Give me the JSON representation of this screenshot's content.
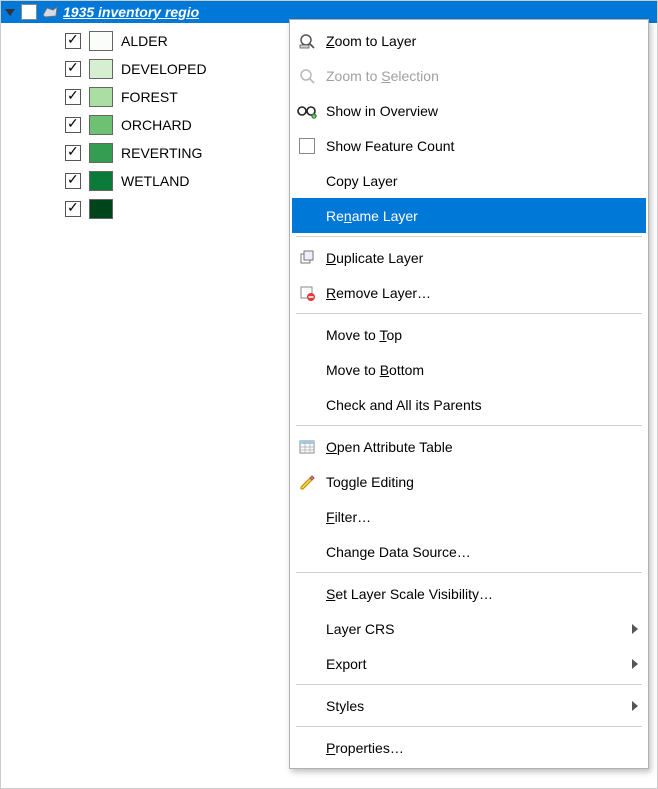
{
  "layer": {
    "title": "1935 inventory regio",
    "checked": false,
    "legend": [
      {
        "label": "ALDER",
        "checked": true,
        "color": "#fbfdfa"
      },
      {
        "label": "DEVELOPED",
        "checked": true,
        "color": "#d7efd1"
      },
      {
        "label": "FOREST",
        "checked": true,
        "color": "#aadea3"
      },
      {
        "label": "ORCHARD",
        "checked": true,
        "color": "#6ec173"
      },
      {
        "label": "REVERTING",
        "checked": true,
        "color": "#359d51"
      },
      {
        "label": "WETLAND",
        "checked": true,
        "color": "#0c7a38"
      },
      {
        "label": "",
        "checked": true,
        "color": "#00441b"
      }
    ]
  },
  "menu": {
    "items": [
      {
        "kind": "item",
        "label_html": "<u>Z</u>oom to Layer",
        "icon": "zoom-layer",
        "disabled": false,
        "name": "menu-zoom-to-layer"
      },
      {
        "kind": "item",
        "label_html": "Zoom to <u>S</u>election",
        "icon": "zoom-selection",
        "disabled": true,
        "name": "menu-zoom-to-selection"
      },
      {
        "kind": "item",
        "label_html": "Show in Overview",
        "icon": "overview",
        "name": "menu-show-in-overview"
      },
      {
        "kind": "item",
        "label_html": "Show Feature Count",
        "icon": "checkbox",
        "name": "menu-show-feature-count"
      },
      {
        "kind": "item",
        "label_html": "Copy Layer",
        "icon": "",
        "name": "menu-copy-layer"
      },
      {
        "kind": "item",
        "label_html": "Re<u>n</u>ame Layer",
        "icon": "",
        "highlight": true,
        "name": "menu-rename-layer"
      },
      {
        "kind": "sep"
      },
      {
        "kind": "item",
        "label_html": "<u>D</u>uplicate Layer",
        "icon": "duplicate",
        "name": "menu-duplicate-layer"
      },
      {
        "kind": "item",
        "label_html": "<u>R</u>emove Layer…",
        "icon": "remove",
        "name": "menu-remove-layer"
      },
      {
        "kind": "sep"
      },
      {
        "kind": "item",
        "label_html": "Move to <u>T</u>op",
        "icon": "",
        "name": "menu-move-to-top"
      },
      {
        "kind": "item",
        "label_html": "Move to <u>B</u>ottom",
        "icon": "",
        "name": "menu-move-to-bottom"
      },
      {
        "kind": "item",
        "label_html": "Check and All its Parents",
        "icon": "",
        "name": "menu-check-parents"
      },
      {
        "kind": "sep"
      },
      {
        "kind": "item",
        "label_html": "<u>O</u>pen Attribute Table",
        "icon": "table",
        "name": "menu-open-attribute-table"
      },
      {
        "kind": "item",
        "label_html": "Toggle Editing",
        "icon": "pencil",
        "name": "menu-toggle-editing"
      },
      {
        "kind": "item",
        "label_html": "<u>F</u>ilter…",
        "icon": "",
        "name": "menu-filter"
      },
      {
        "kind": "item",
        "label_html": "Change Data Source…",
        "icon": "",
        "name": "menu-change-data-source"
      },
      {
        "kind": "sep"
      },
      {
        "kind": "item",
        "label_html": "<u>S</u>et Layer Scale Visibility…",
        "icon": "",
        "name": "menu-set-scale-visibility"
      },
      {
        "kind": "item",
        "label_html": "Layer CRS",
        "icon": "",
        "submenu": true,
        "name": "menu-layer-crs"
      },
      {
        "kind": "item",
        "label_html": "Export",
        "icon": "",
        "submenu": true,
        "name": "menu-export"
      },
      {
        "kind": "sep"
      },
      {
        "kind": "item",
        "label_html": "Styles",
        "icon": "",
        "submenu": true,
        "name": "menu-styles"
      },
      {
        "kind": "sep"
      },
      {
        "kind": "item",
        "label_html": "<u>P</u>roperties…",
        "icon": "",
        "name": "menu-properties"
      }
    ]
  }
}
